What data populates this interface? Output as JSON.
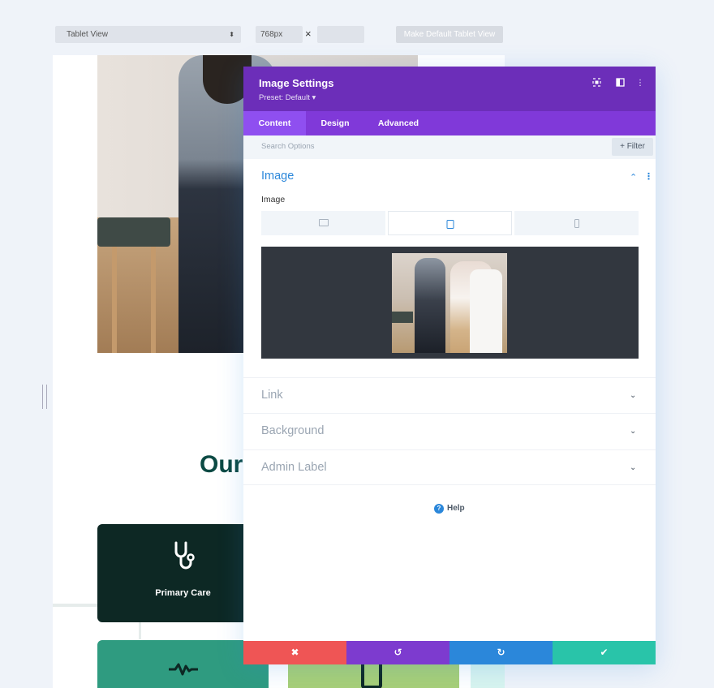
{
  "toolbar": {
    "view_select": "Tablet View",
    "view_select_arrows": "⬍",
    "width_value": "768px",
    "times": "×",
    "make_default": "Make Default Tablet View"
  },
  "preview": {
    "heading": "Our",
    "cards": [
      {
        "label": "Primary Care",
        "icon": "stethoscope-icon",
        "color": "#0d2824"
      },
      {
        "icon": "heartbeat-icon",
        "color": "#2f9b80"
      },
      {
        "icon": "clipboard-icon",
        "color": "#a7cf77"
      }
    ]
  },
  "modal": {
    "title": "Image Settings",
    "preset": "Preset: Default ▾",
    "header_icons": [
      "focus-icon",
      "sidebar-toggle-icon",
      "more-vertical-icon"
    ],
    "tabs": [
      {
        "label": "Content",
        "active": true
      },
      {
        "label": "Design",
        "active": false
      },
      {
        "label": "Advanced",
        "active": false
      }
    ],
    "search_placeholder": "Search Options",
    "filter_label": "+ Filter",
    "sections": {
      "image": {
        "title": "Image",
        "field_label": "Image",
        "active_device": "tablet"
      },
      "link": {
        "title": "Link"
      },
      "background": {
        "title": "Background"
      },
      "admin_label": {
        "title": "Admin Label"
      }
    },
    "help": "Help",
    "footer": [
      {
        "name": "cancel",
        "glyph": "✖",
        "color": "#ef5555"
      },
      {
        "name": "undo",
        "glyph": "↺",
        "color": "#7d3bcf"
      },
      {
        "name": "redo",
        "glyph": "↻",
        "color": "#2b87da"
      },
      {
        "name": "save",
        "glyph": "✔",
        "color": "#29c4a9"
      }
    ],
    "colors": {
      "header": "#6c2eb9",
      "tabs": "#8039d9",
      "accent": "#2b87da"
    }
  }
}
